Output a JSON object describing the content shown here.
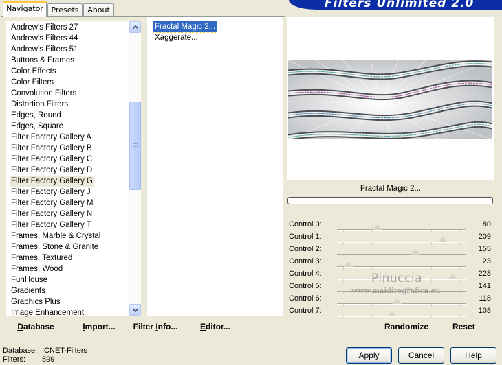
{
  "banner": {
    "title": "Filters Unlimited 2.0"
  },
  "tabs": [
    {
      "label": "Navigator",
      "active": true
    },
    {
      "label": "Presets",
      "active": false
    },
    {
      "label": "About",
      "active": false
    }
  ],
  "categories": {
    "items": [
      "Andrew's Filters 27",
      "Andrew's Filters 44",
      "Andrew's Filters 51",
      "Buttons & Frames",
      "Color Effects",
      "Color Filters",
      "Convolution Filters",
      "Distortion Filters",
      "Edges, Round",
      "Edges, Square",
      "Filter Factory Gallery A",
      "Filter Factory Gallery B",
      "Filter Factory Gallery C",
      "Filter Factory Gallery D",
      "Filter Factory Gallery G",
      "Filter Factory Gallery J",
      "Filter Factory Gallery M",
      "Filter Factory Gallery N",
      "Filter Factory Gallery T",
      "Frames, Marble & Crystal",
      "Frames, Stone & Granite",
      "Frames, Textured",
      "Frames, Wood",
      "FunHouse",
      "Gradients",
      "Graphics Plus",
      "Image Enhancement"
    ],
    "selected": "Filter Factory Gallery G"
  },
  "filters": {
    "items": [
      "Fractal Magic 2...",
      "Xaggerate..."
    ],
    "selected": "Fractal Magic 2..."
  },
  "left_buttons": {
    "database": {
      "underline": "D",
      "rest": "atabase"
    },
    "import": {
      "underline": "I",
      "rest": "mport..."
    },
    "filter_info": {
      "pre": "Filter ",
      "underline": "I",
      "rest": "nfo..."
    },
    "editor": {
      "underline": "E",
      "rest": "ditor..."
    }
  },
  "preview": {
    "filter_name": "Fractal Magic 2..."
  },
  "controls": [
    {
      "label": "Control 0:",
      "value": "80"
    },
    {
      "label": "Control 1:",
      "value": "209"
    },
    {
      "label": "Control 2:",
      "value": "155"
    },
    {
      "label": "Control 3:",
      "value": "23"
    },
    {
      "label": "Control 4:",
      "value": "228"
    },
    {
      "label": "Control 5:",
      "value": "141"
    },
    {
      "label": "Control 6:",
      "value": "118"
    },
    {
      "label": "Control 7:",
      "value": "108"
    }
  ],
  "actions": {
    "randomize": "Randomize",
    "reset": "Reset"
  },
  "watermark": {
    "name": "Pinuccia",
    "site": "www.maidiregrafica.eu"
  },
  "status": {
    "database_label": "Database:",
    "database_value": "ICNET-Filters",
    "filters_label": "Filters:",
    "filters_value": "599"
  },
  "dialog_buttons": {
    "apply": "Apply",
    "cancel": "Cancel",
    "help": "Help"
  },
  "colors": {
    "selection": "#316ac5",
    "banner": "#0b2da6",
    "face": "#ece9d8"
  }
}
